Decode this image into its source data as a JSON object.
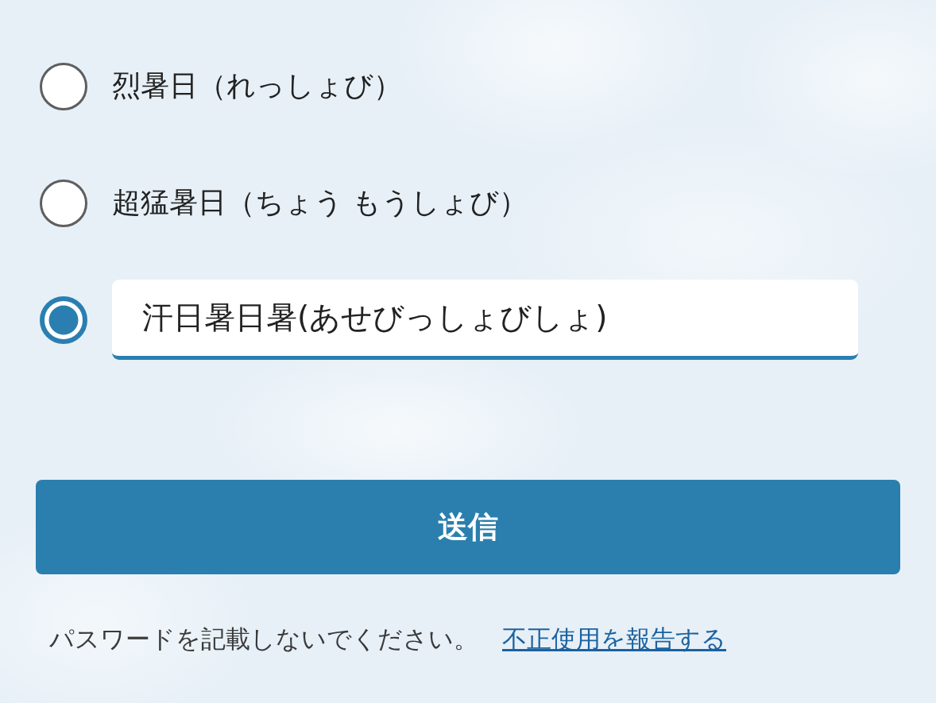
{
  "options": [
    {
      "kind": "label",
      "label": "烈暑日（れっしょび）",
      "selected": false
    },
    {
      "kind": "label",
      "label": "超猛暑日（ちょう もうしょび）",
      "selected": false
    },
    {
      "kind": "input",
      "value": "汗日暑日暑(あせびっしょびしょ)",
      "selected": true
    }
  ],
  "submit_button": {
    "label": "送信"
  },
  "footer": {
    "note": "パスワードを記載しないでください。",
    "link": "不正使用を報告する"
  }
}
